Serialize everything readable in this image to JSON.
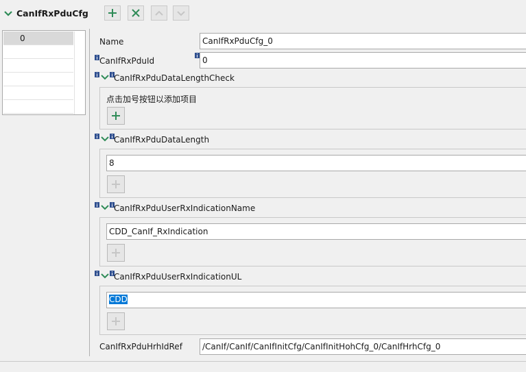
{
  "header": {
    "title": "CanIfRxPduCfg",
    "toolbar": [
      "add-icon",
      "delete-icon",
      "move-up-icon",
      "move-down-icon"
    ]
  },
  "list": {
    "items": [
      "0"
    ],
    "selected": "0"
  },
  "form": {
    "name_label": "Name",
    "name_value": "CanIfRxPduCfg_0",
    "pduid_label": "CanIfRxPduId",
    "pduid_value": "0",
    "dlc_check_label": "CanIfRxPduDataLengthCheck",
    "dlc_check_hint": "点击加号按钮以添加项目",
    "dlc_label": "CanIfRxPduDataLength",
    "dlc_value": "8",
    "user_name_label": "CanIfRxPduUserRxIndicationName",
    "user_name_value": "CDD_CanIf_RxIndication",
    "user_ul_label": "CanIfRxPduUserRxIndicationUL",
    "user_ul_value": "CDD",
    "hrh_label": "CanIfRxPduHrhIdRef",
    "hrh_value": "/CanIf/CanIf/CanIfInitCfg/CanIfInitHohCfg_0/CanIfHrhCfg_0"
  },
  "colors": {
    "accent_green": "#2e8b57",
    "selection_blue": "#0078d7"
  }
}
